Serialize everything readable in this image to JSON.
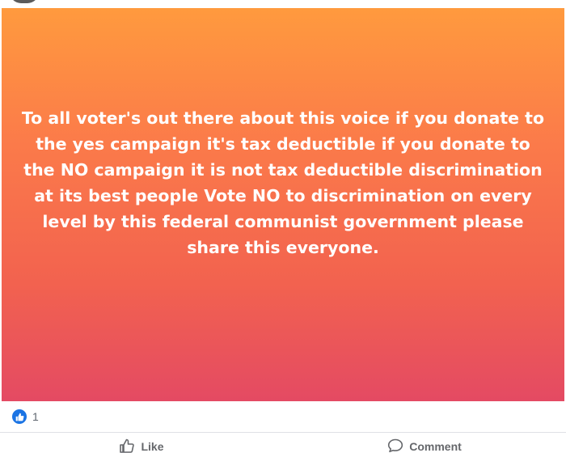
{
  "post": {
    "text": "To all voter's out there about this voice if you donate to the yes campaign it's tax deductible if you donate to the NO campaign it is not tax deductible discrimination at its best people Vote NO to discrimination on every level by this federal communist government please share this everyone.",
    "background_colors": [
      "#ff9a3e",
      "#fb7a4a",
      "#f2624f",
      "#e44a63"
    ]
  },
  "reactions": {
    "icon": "like-icon",
    "count": "1",
    "accent": "#1b74e4"
  },
  "actions": {
    "like_label": "Like",
    "comment_label": "Comment"
  }
}
